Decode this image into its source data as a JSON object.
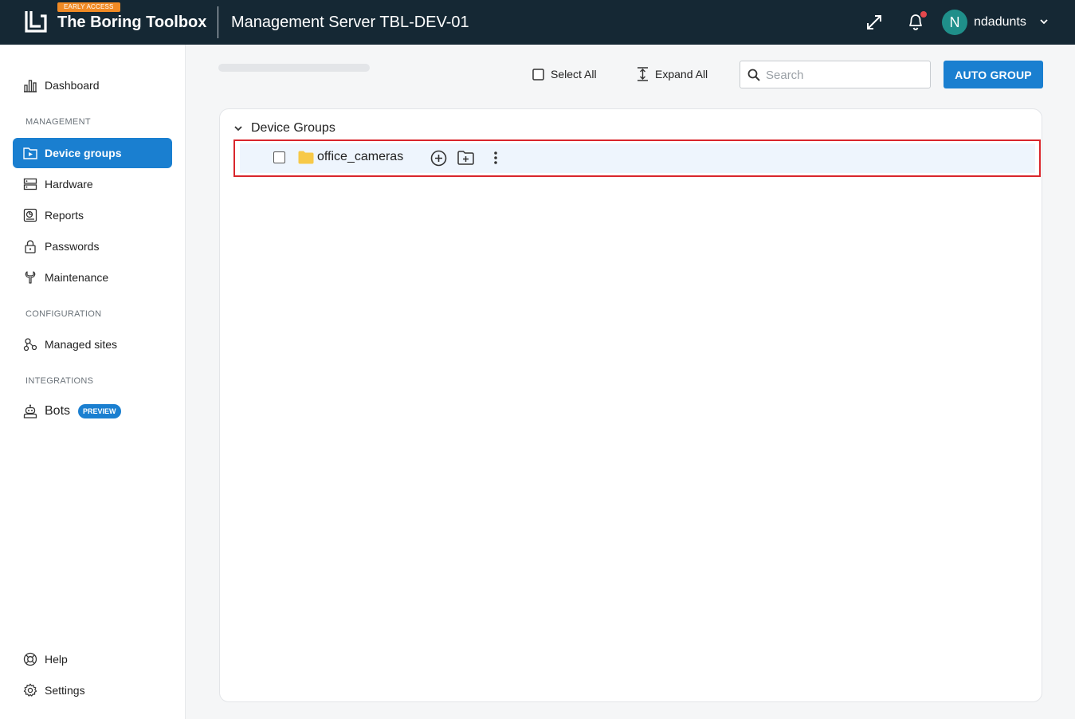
{
  "header": {
    "badge": "EARLY ACCESS",
    "app_name": "The Boring Toolbox",
    "server_title": "Management Server TBL-DEV-01",
    "user": {
      "initial": "N",
      "name": "ndadunts"
    }
  },
  "sidebar": {
    "items": [
      {
        "label": "Dashboard",
        "icon": "bar-chart-icon"
      },
      {
        "label": "Device groups",
        "icon": "device-group-icon",
        "active": true
      },
      {
        "label": "Hardware",
        "icon": "server-icon"
      },
      {
        "label": "Reports",
        "icon": "report-icon"
      },
      {
        "label": "Passwords",
        "icon": "lock-icon"
      },
      {
        "label": "Maintenance",
        "icon": "wrench-icon"
      },
      {
        "label": "Managed sites",
        "icon": "sites-icon"
      },
      {
        "label": "Bots",
        "icon": "robot-icon",
        "badge": "PREVIEW"
      },
      {
        "label": "Help",
        "icon": "lifebuoy-icon"
      },
      {
        "label": "Settings",
        "icon": "gear-icon"
      }
    ],
    "sections": {
      "management": "MANAGEMENT",
      "configuration": "CONFIGURATION",
      "integrations": "INTEGRATIONS"
    }
  },
  "toolbar": {
    "select_all": "Select All",
    "expand_all": "Expand All",
    "search_placeholder": "Search",
    "auto_group": "AUTO GROUP"
  },
  "tree": {
    "root_label": "Device Groups",
    "groups": [
      {
        "name": "office_cameras",
        "checked": false
      }
    ]
  },
  "colors": {
    "topbar": "#152834",
    "accent": "#1a7fd0",
    "badge_orange": "#f08a24",
    "highlight_red": "#d9262c",
    "folder": "#f7c948"
  }
}
